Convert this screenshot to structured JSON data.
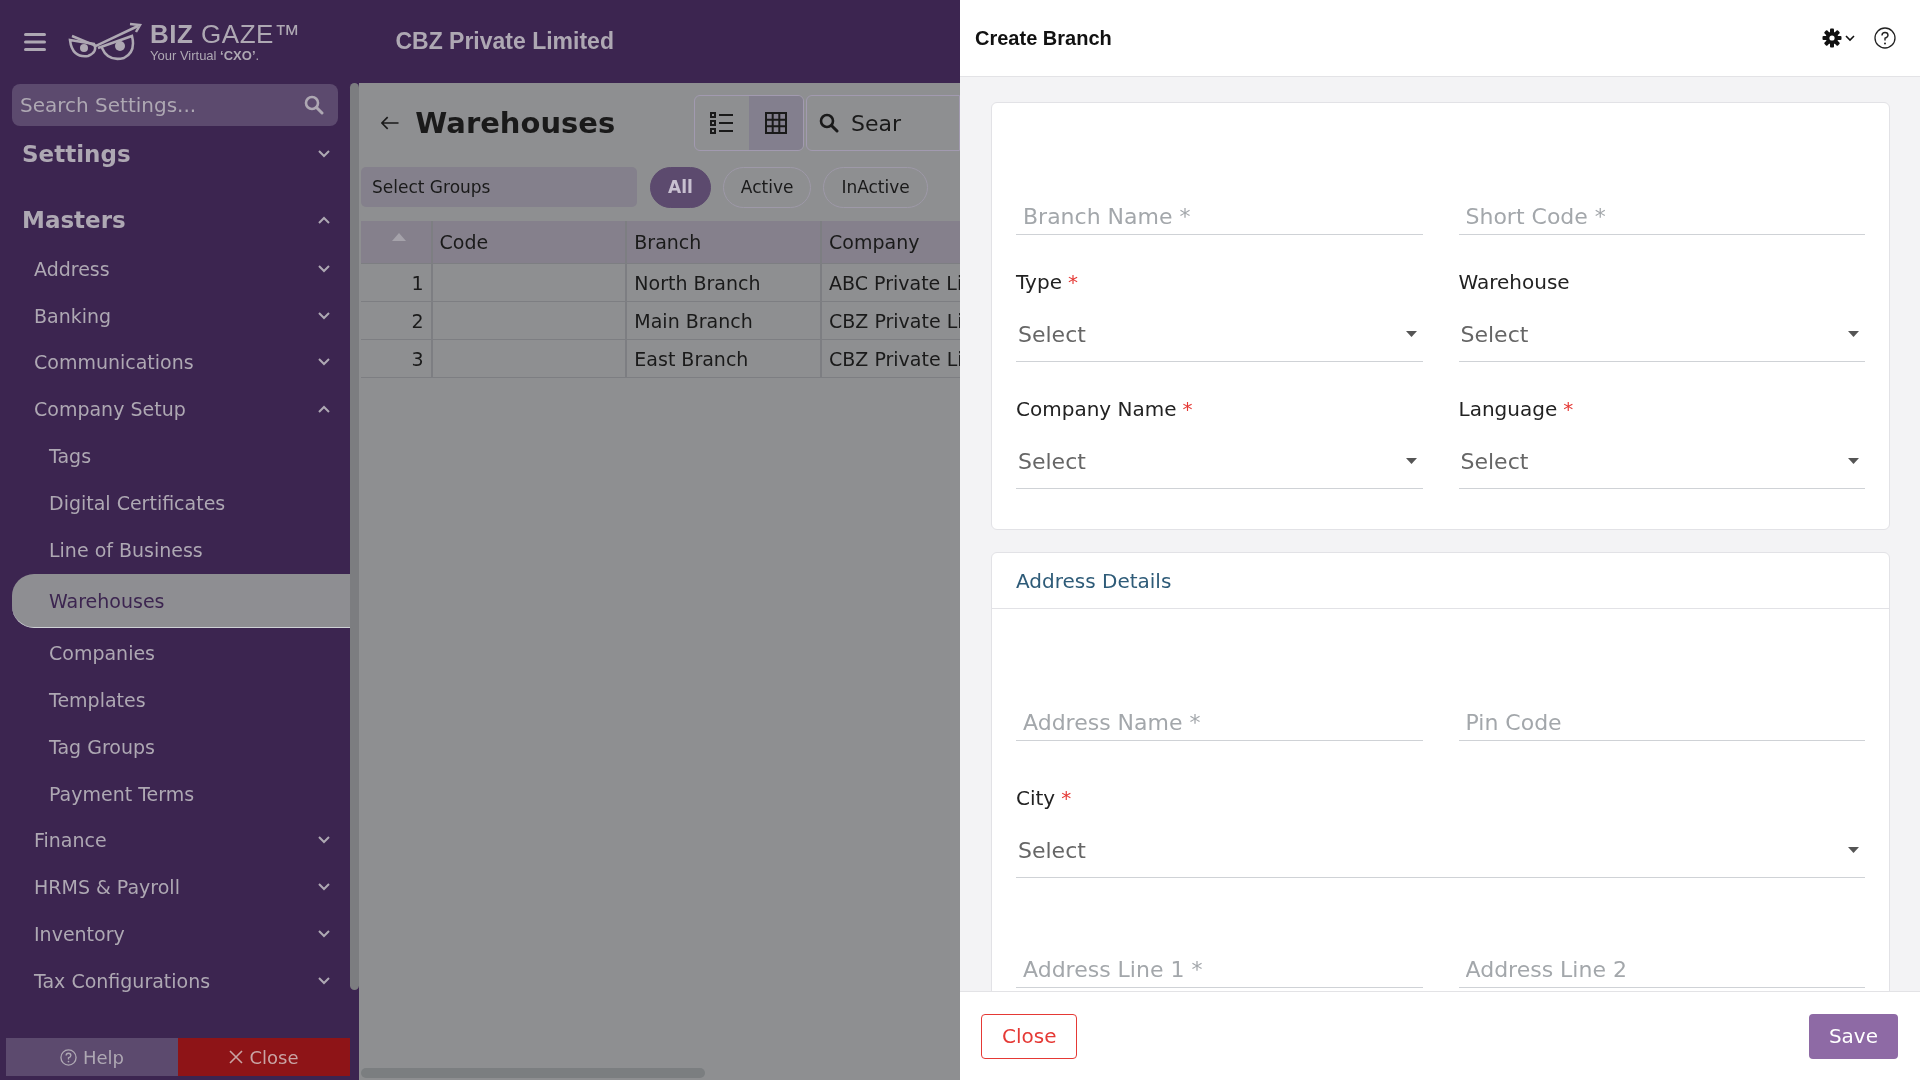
{
  "header": {
    "logo": {
      "name": "**BIZ** GAZE™",
      "tagline": "Your Virtual **‘CXO’**."
    },
    "title": "CBZ Private Limited"
  },
  "sidebar": {
    "search": {
      "placeholder": "Search Settings..."
    },
    "items": [
      {
        "label": "Settings",
        "selected": false,
        "expanded": false
      },
      {
        "label": "Masters",
        "selected": false,
        "expanded": true,
        "children": [
          {
            "label": "Address",
            "selected": false,
            "expanded": false
          },
          {
            "label": "Banking",
            "selected": false,
            "expanded": false
          },
          {
            "label": "Communications",
            "selected": false,
            "expanded": false
          },
          {
            "label": "Company Setup",
            "selected": false,
            "expanded": true,
            "children": [
              {
                "label": "Tags",
                "selected": false
              },
              {
                "label": "Digital Certificates",
                "selected": false
              },
              {
                "label": "Line of Business",
                "selected": false
              },
              {
                "label": "Warehouses",
                "selected": true
              },
              {
                "label": "Companies",
                "selected": false
              },
              {
                "label": "Templates",
                "selected": false
              },
              {
                "label": "Tag Groups",
                "selected": false
              },
              {
                "label": "Payment Terms",
                "selected": false
              }
            ]
          },
          {
            "label": "Finance",
            "selected": false,
            "expanded": false
          },
          {
            "label": "HRMS & Payroll",
            "selected": false,
            "expanded": false
          },
          {
            "label": "Inventory",
            "selected": false,
            "expanded": false
          },
          {
            "label": "Tax Configurations",
            "selected": false,
            "expanded": false
          }
        ]
      }
    ],
    "footer": {
      "help": "Help",
      "close": "Close"
    }
  },
  "page": {
    "title": "Warehouses",
    "view_toggle": [
      {
        "kind": "list",
        "selected": false
      },
      {
        "kind": "grid",
        "selected": true
      }
    ],
    "search": {
      "placeholder": "Sear"
    },
    "groups": {
      "placeholder": "Select Groups"
    },
    "filters": [
      {
        "label": "All",
        "selected": true
      },
      {
        "label": "Active",
        "selected": false
      },
      {
        "label": "InActive",
        "selected": false
      }
    ],
    "table": {
      "columns": [
        "Code",
        "Branch",
        "Company"
      ],
      "rows": [
        {
          "index": "1",
          "cells": [
            "",
            "North Branch",
            "ABC Private Li"
          ]
        },
        {
          "index": "2",
          "cells": [
            "",
            "Main Branch",
            "CBZ Private Li"
          ]
        },
        {
          "index": "3",
          "cells": [
            "",
            "East Branch",
            "CBZ Private Li"
          ]
        }
      ]
    }
  },
  "dialog": {
    "title": "Create Branch",
    "sections": [
      {
        "fields": [
          {
            "kind": "text",
            "placeholder": "Branch Name *"
          },
          {
            "kind": "text",
            "placeholder": "Short Code *"
          },
          {
            "kind": "select",
            "label": "Type",
            "mark": "*",
            "placeholder": "Select"
          },
          {
            "kind": "select",
            "label": "Warehouse",
            "placeholder": "Select"
          },
          {
            "kind": "select",
            "label": "Company Name",
            "mark": "*",
            "placeholder": "Select"
          },
          {
            "kind": "select",
            "label": "Language",
            "mark": "*",
            "placeholder": "Select"
          }
        ]
      },
      {
        "title": "Address Details",
        "fields": [
          {
            "kind": "text",
            "placeholder": "Address Name *"
          },
          {
            "kind": "text",
            "placeholder": "Pin Code"
          },
          {
            "kind": "select",
            "label": "City",
            "mark": "*",
            "placeholder": "Select",
            "wide": true
          },
          {
            "kind": "text",
            "placeholder": "Address Line 1 *"
          },
          {
            "kind": "text",
            "placeholder": "Address Line 2"
          }
        ]
      }
    ],
    "buttons": {
      "close": "Close",
      "save": "Save"
    }
  }
}
